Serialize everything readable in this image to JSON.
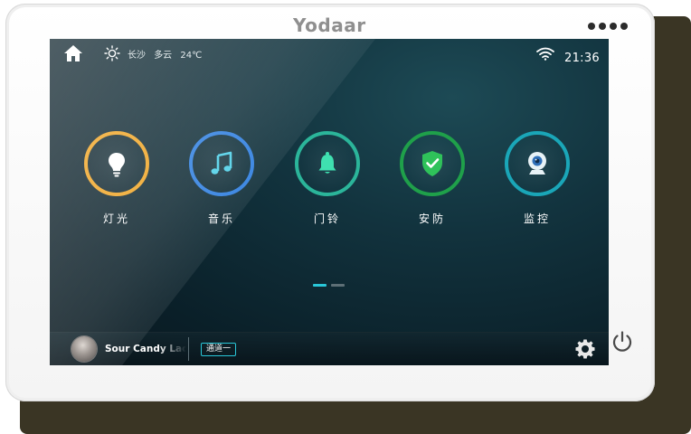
{
  "device": {
    "brand": "Yodaar",
    "icons": [
      "home-icon",
      "sun-icon",
      "wifi-icon",
      "gear-icon",
      "power-icon"
    ]
  },
  "topbar": {
    "city": "长沙",
    "weather": "多云",
    "temperature": "24℃",
    "time": "21:36"
  },
  "apps": [
    {
      "label": "灯光",
      "icon": "lightbulb-icon",
      "ring_color": "#f0a422"
    },
    {
      "label": "音乐",
      "icon": "music-note-icon",
      "ring_color": "#2f7fe0"
    },
    {
      "label": "门铃",
      "icon": "bell-icon",
      "ring_color": "#2bb59a"
    },
    {
      "label": "安防",
      "icon": "shield-check-icon",
      "ring_color": "#1fa04a"
    },
    {
      "label": "监控",
      "icon": "camera-icon",
      "ring_color": "#1aa6b8"
    }
  ],
  "pager": {
    "pages": 2,
    "active": 1,
    "accent": "#29c7d8"
  },
  "player": {
    "song": "Sour Candy Lady",
    "channel": "通道一"
  }
}
